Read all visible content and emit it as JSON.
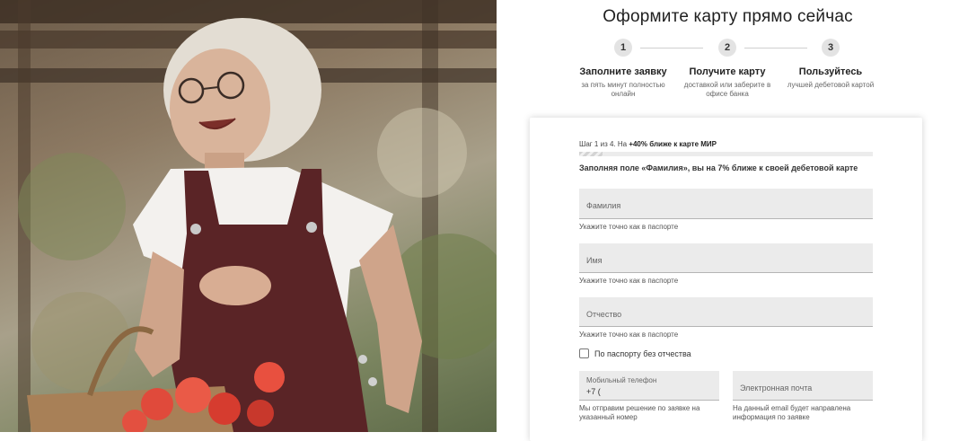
{
  "page": {
    "title": "Оформите карту прямо сейчас"
  },
  "steps": [
    {
      "num": "1",
      "title": "Заполните заявку",
      "sub": "за пять минут полностью онлайн"
    },
    {
      "num": "2",
      "title": "Получите карту",
      "sub": "доставкой или заберите в офисе банка"
    },
    {
      "num": "3",
      "title": "Пользуйтесь",
      "sub": "лучшей дебетовой картой"
    }
  ],
  "form": {
    "progress_prefix": "Шаг 1 из 4. На",
    "progress_bold": "+40% ближе к карте МИР",
    "progress_fraction": 0.08,
    "hint": "Заполняя поле «Фамилия», вы на 7% ближе к своей дебетовой карте",
    "fields": {
      "last_name": {
        "placeholder": "Фамилия",
        "helper": "Укажите точно как в паспорте"
      },
      "first_name": {
        "placeholder": "Имя",
        "helper": "Укажите точно как в паспорте"
      },
      "patronymic": {
        "placeholder": "Отчество",
        "helper": "Укажите точно как в паспорте"
      },
      "phone": {
        "label": "Мобильный телефон",
        "value": "+7 (",
        "helper": "Мы отправим решение по заявке на указанный номер"
      },
      "email": {
        "placeholder": "Электронная почта",
        "helper": "На данный email будет направлена информация по заявке"
      }
    },
    "no_patronymic_label": "По паспорту без отчества"
  },
  "colors": {
    "field_bg": "#ebebeb",
    "step_circle": "#e3e3e3",
    "text": "#222222"
  }
}
